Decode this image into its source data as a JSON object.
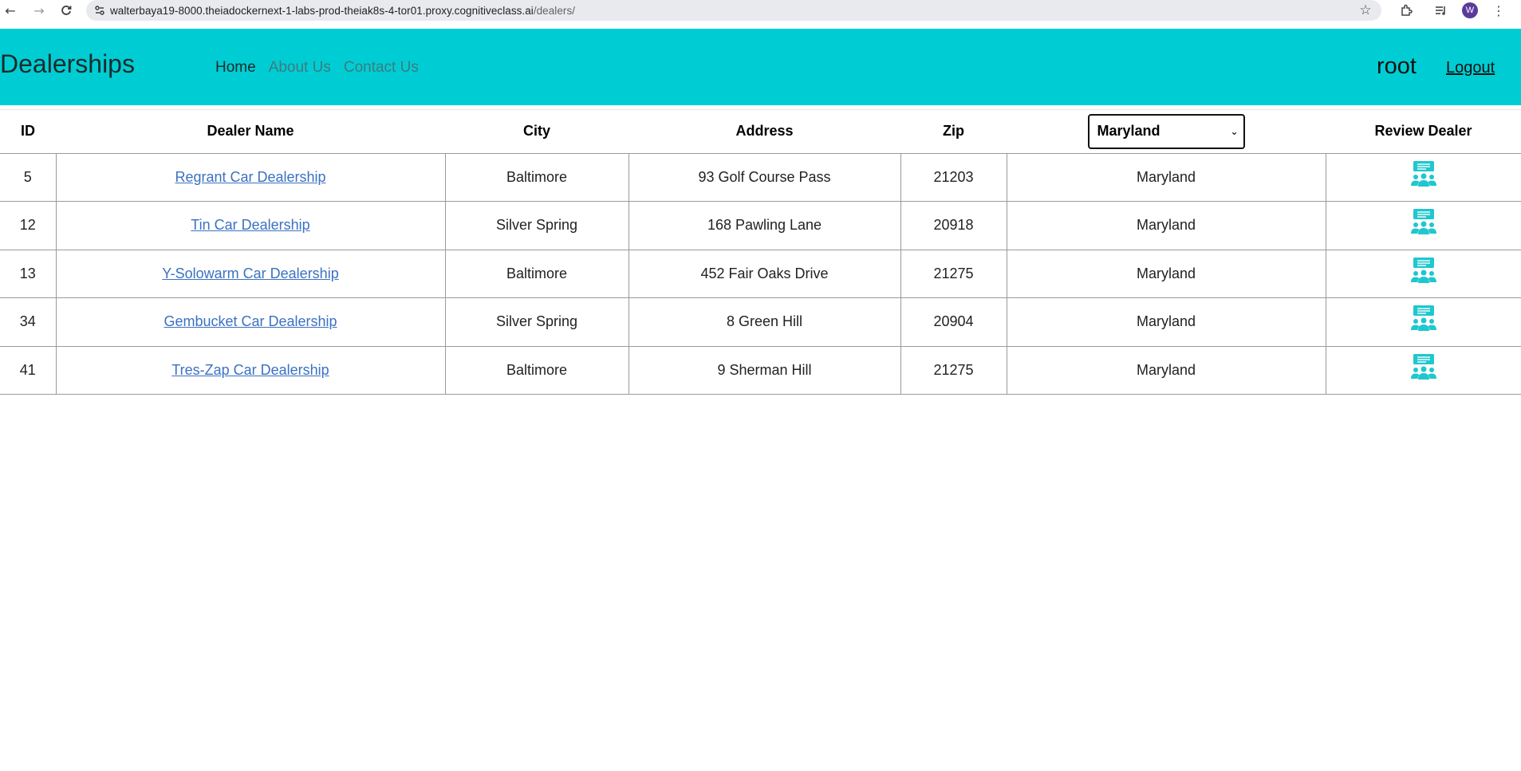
{
  "browser": {
    "url_host": "walterbaya19-8000.theiadockernext-1-labs-prod-theiak8s-4-tor01.proxy.cognitiveclass.ai",
    "url_path": "/dealers/",
    "profile_initial": "W"
  },
  "header": {
    "brand": "Dealerships",
    "nav": [
      "Home",
      "About Us",
      "Contact Us"
    ],
    "user": "root",
    "logout": "Logout"
  },
  "table": {
    "columns": [
      "ID",
      "Dealer Name",
      "City",
      "Address",
      "Zip",
      "Review Dealer"
    ],
    "state_filter": "Maryland",
    "rows": [
      {
        "id": "5",
        "name": "Regrant Car Dealership",
        "city": "Baltimore",
        "address": "93 Golf Course Pass",
        "zip": "21203",
        "state": "Maryland"
      },
      {
        "id": "12",
        "name": "Tin Car Dealership",
        "city": "Silver Spring",
        "address": "168 Pawling Lane",
        "zip": "20918",
        "state": "Maryland"
      },
      {
        "id": "13",
        "name": "Y-Solowarm Car Dealership",
        "city": "Baltimore",
        "address": "452 Fair Oaks Drive",
        "zip": "21275",
        "state": "Maryland"
      },
      {
        "id": "34",
        "name": "Gembucket Car Dealership",
        "city": "Silver Spring",
        "address": "8 Green Hill",
        "zip": "20904",
        "state": "Maryland"
      },
      {
        "id": "41",
        "name": "Tres-Zap Car Dealership",
        "city": "Baltimore",
        "address": "9 Sherman Hill",
        "zip": "21275",
        "state": "Maryland"
      }
    ]
  },
  "colors": {
    "header_bg": "#00cdd3",
    "link": "#3b71c2",
    "icon": "#1fc7ce"
  },
  "icons": [
    "back-arrow-icon",
    "forward-arrow-icon",
    "reload-icon",
    "site-info-icon",
    "star-icon",
    "extensions-icon",
    "media-icon",
    "menu-icon",
    "review-icon"
  ]
}
